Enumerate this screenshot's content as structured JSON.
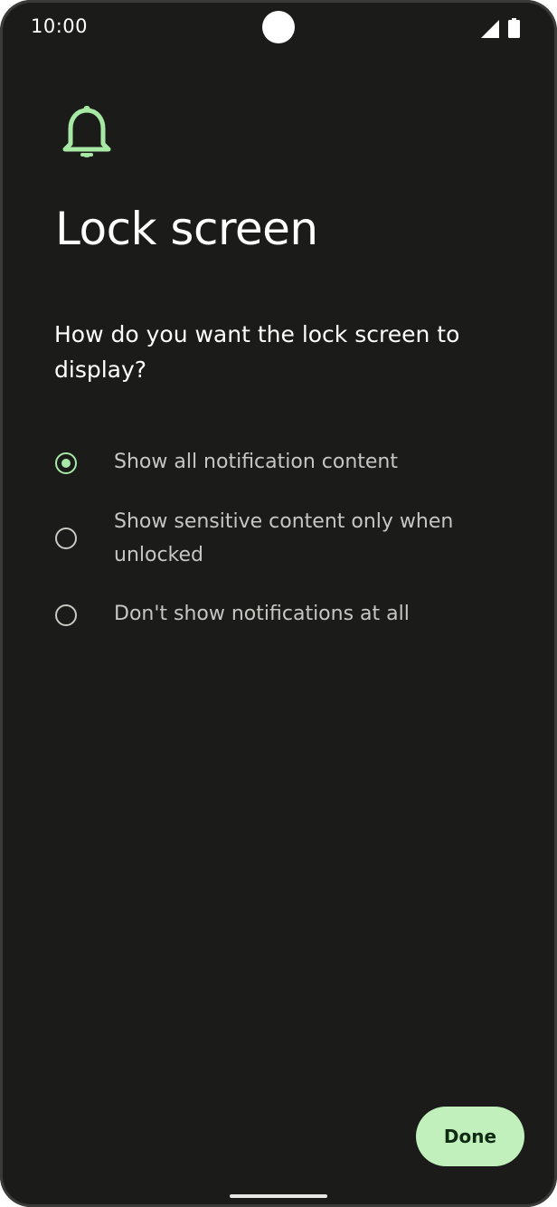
{
  "status_bar": {
    "time": "10:00",
    "icons": [
      "camera-cutout",
      "signal-icon",
      "battery-icon"
    ]
  },
  "header": {
    "icon": "bell-icon",
    "title": "Lock screen"
  },
  "main": {
    "question": "How do you want the lock screen to display?",
    "options": [
      {
        "label": "Show all notification content",
        "selected": true
      },
      {
        "label": "Show sensitive content only when unlocked",
        "selected": false
      },
      {
        "label": "Don't show notifications at all",
        "selected": false
      }
    ]
  },
  "footer": {
    "done_label": "Done"
  },
  "colors": {
    "background": "#1b1c1a",
    "accent": "#a8e8a5",
    "button_bg": "#c2f0bd",
    "text_primary": "#ffffff",
    "text_secondary": "#c6c7c2"
  }
}
